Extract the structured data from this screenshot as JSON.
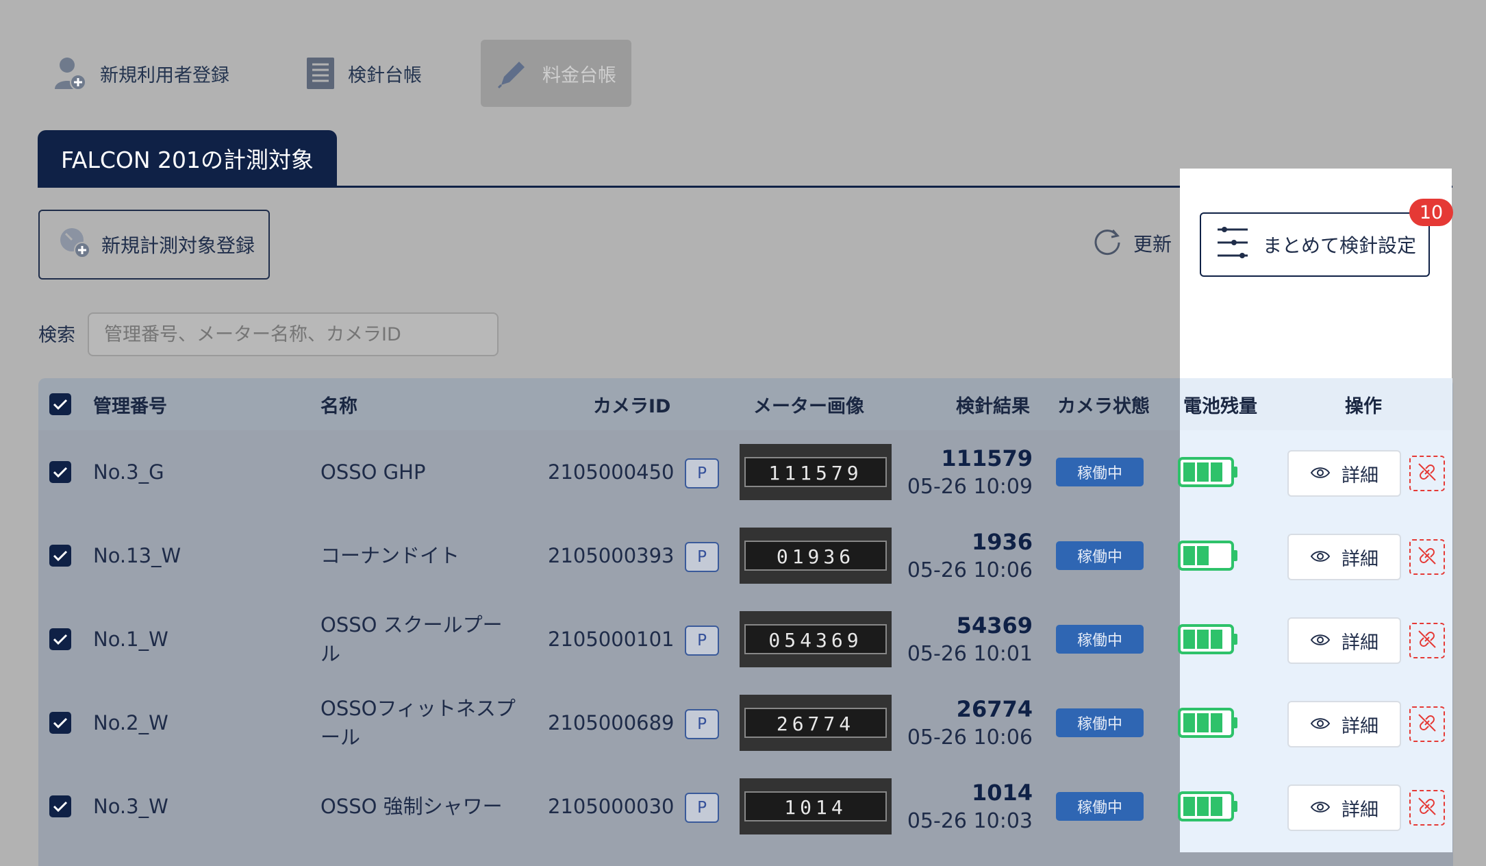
{
  "nav": {
    "items": [
      {
        "label": "新規利用者登録",
        "icon": "user-add-icon"
      },
      {
        "label": "検針台帳",
        "icon": "ledger-icon"
      },
      {
        "label": "料金台帳",
        "icon": "pencil-icon",
        "active": true
      }
    ]
  },
  "tab": {
    "label": "FALCON 201の計測対象"
  },
  "toolbar": {
    "register_label": "新規計測対象登録",
    "refresh_label": "更新",
    "bulk_label": "まとめて検針設定",
    "bulk_badge": "10"
  },
  "search": {
    "label": "検索",
    "placeholder": "管理番号、メーター名称、カメラID"
  },
  "table": {
    "headers": {
      "id": "管理番号",
      "name": "名称",
      "camera": "カメラID",
      "image": "メーター画像",
      "result": "検針結果",
      "cam_status": "カメラ状態",
      "battery": "電池残量",
      "ops": "操作"
    },
    "rows": [
      {
        "id": "No.3_G",
        "name": "OSSO GHP",
        "camera": "2105000450",
        "p": "P",
        "meter_digits": "111579",
        "value": "111579",
        "time": "05-26 10:09",
        "status": "稼働中",
        "battery": 3,
        "detail": "詳細"
      },
      {
        "id": "No.13_W",
        "name": "コーナンドイト",
        "camera": "2105000393",
        "p": "P",
        "meter_digits": "01936",
        "value": "1936",
        "time": "05-26 10:06",
        "status": "稼働中",
        "battery": 2,
        "detail": "詳細"
      },
      {
        "id": "No.1_W",
        "name": "OSSO スクールプール",
        "camera": "2105000101",
        "p": "P",
        "meter_digits": "054369",
        "value": "54369",
        "time": "05-26 10:01",
        "status": "稼働中",
        "battery": 3,
        "detail": "詳細"
      },
      {
        "id": "No.2_W",
        "name": "OSSOフィットネスプール",
        "camera": "2105000689",
        "p": "P",
        "meter_digits": "26774",
        "value": "26774",
        "time": "05-26 10:06",
        "status": "稼働中",
        "battery": 3,
        "detail": "詳細"
      },
      {
        "id": "No.3_W",
        "name": "OSSO 強制シャワー",
        "camera": "2105000030",
        "p": "P",
        "meter_digits": "1014",
        "value": "1014",
        "time": "05-26 10:03",
        "status": "稼働中",
        "battery": 3,
        "detail": "詳細"
      }
    ]
  },
  "colors": {
    "accent": "#0f2146",
    "status": "#2f66b3",
    "battery": "#2ec26a",
    "alert": "#e53935"
  }
}
